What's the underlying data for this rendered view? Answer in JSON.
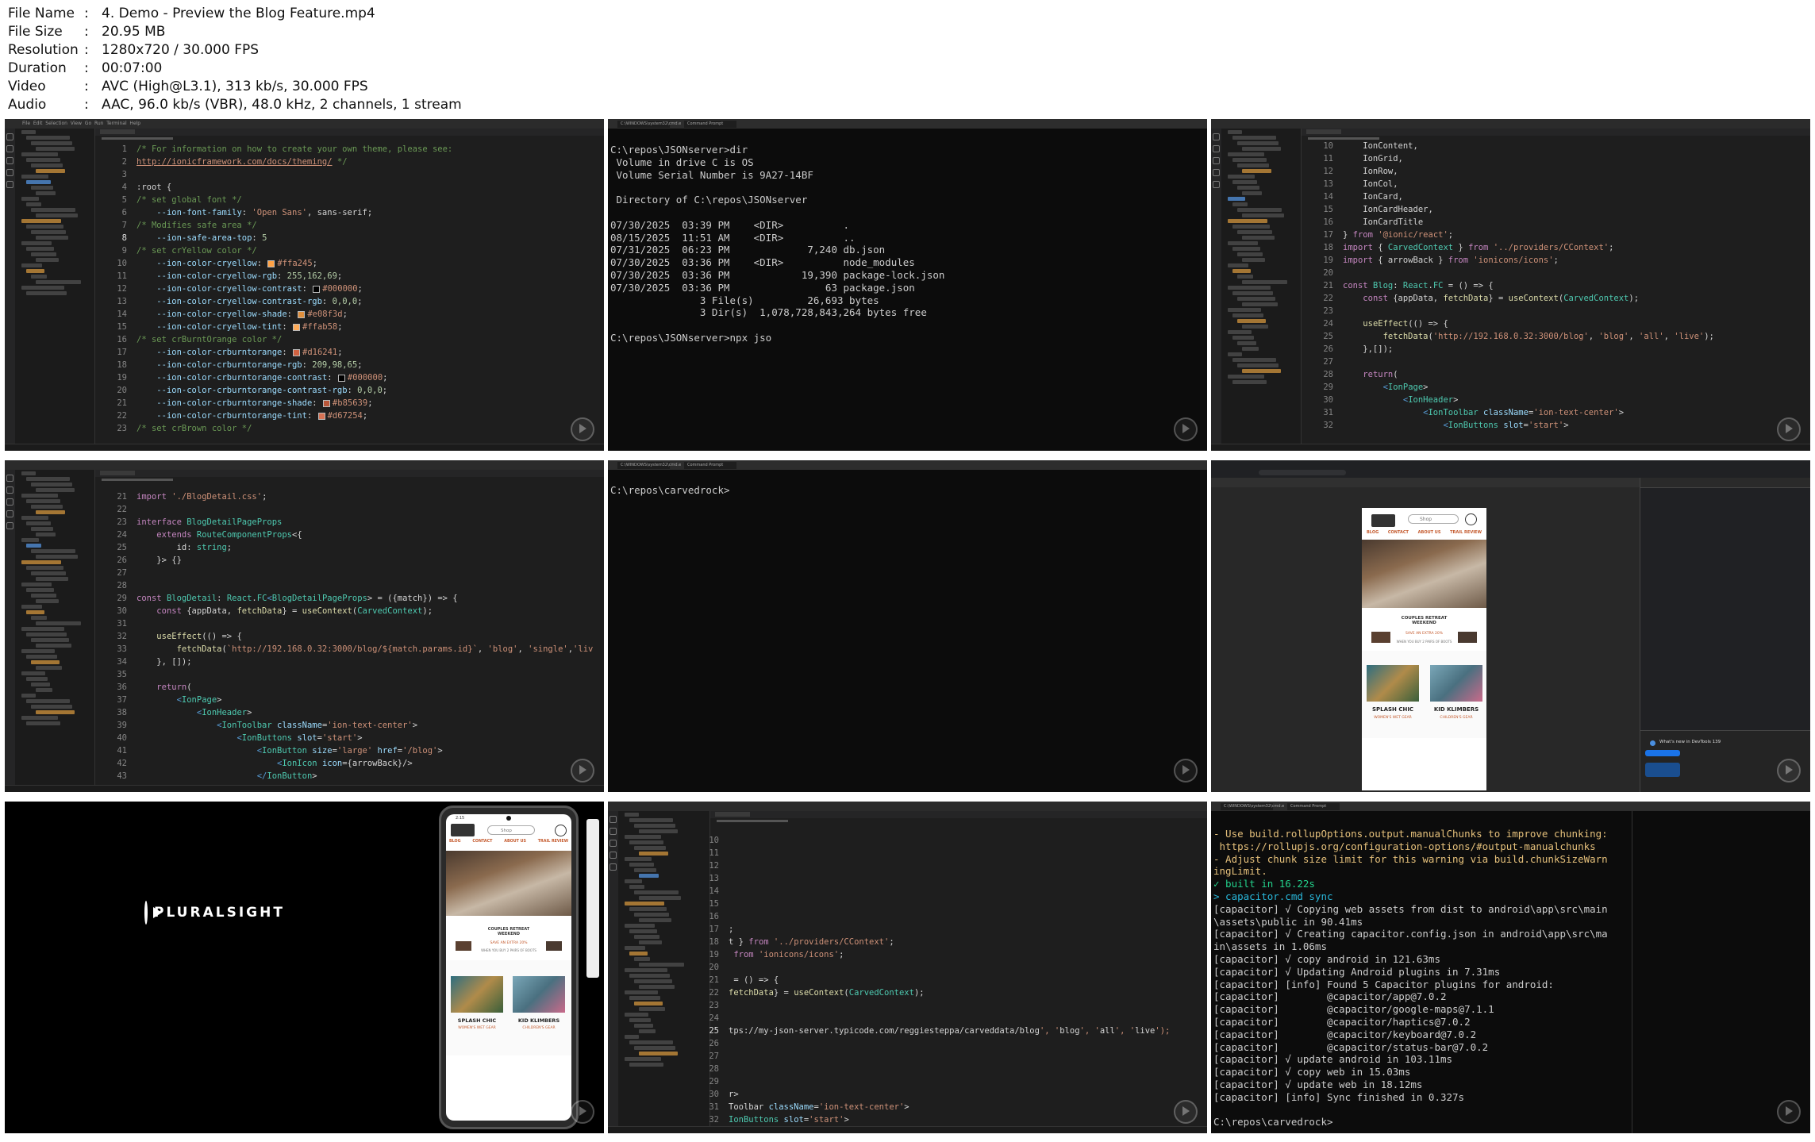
{
  "file_info": [
    {
      "key": "File Name",
      "value": "4. Demo - Preview the Blog Feature.mp4"
    },
    {
      "key": "File Size",
      "value": "20.95 MB"
    },
    {
      "key": "Resolution",
      "value": "1280x720 / 30.000 FPS"
    },
    {
      "key": "Duration",
      "value": "00:07:00"
    },
    {
      "key": "Video",
      "value": "AVC (High@L3.1), 313 kb/s, 30.000 FPS"
    },
    {
      "key": "Audio",
      "value": "AAC, 96.0 kb/s (VBR), 48.0 kHz, 2 channels, 1 stream"
    }
  ],
  "thumb1": {
    "menu": "File  Edit  Selection  View  Go  Run  Terminal  Help",
    "lines": [
      {
        "n": "1",
        "t": "/* For information on how to create your own theme, please see:"
      },
      {
        "n": "2",
        "t": "http://ionicframework.com/docs/theming/ */"
      },
      {
        "n": "3",
        "t": ""
      },
      {
        "n": "4",
        "t": ":root {"
      },
      {
        "n": "5",
        "t": "/* set global font */"
      },
      {
        "n": "6",
        "t": "    --ion-font-family: 'Open Sans', sans-serif;"
      },
      {
        "n": "7",
        "t": "/* Modifies safe area */"
      },
      {
        "n": "8",
        "t": "    --ion-safe-area-top: 5"
      },
      {
        "n": "9",
        "t": "/* set crYellow color */"
      },
      {
        "n": "10",
        "t": "    --ion-color-cryellow: #ffa245;"
      },
      {
        "n": "11",
        "t": "    --ion-color-cryellow-rgb: 255,162,69;"
      },
      {
        "n": "12",
        "t": "    --ion-color-cryellow-contrast: #000000;"
      },
      {
        "n": "13",
        "t": "    --ion-color-cryellow-contrast-rgb: 0,0,0;"
      },
      {
        "n": "14",
        "t": "    --ion-color-cryellow-shade: #e08f3d;"
      },
      {
        "n": "15",
        "t": "    --ion-color-cryellow-tint: #ffab58;"
      },
      {
        "n": "16",
        "t": "/* set crBurntOrange color */"
      },
      {
        "n": "17",
        "t": "    --ion-color-crburntorange: #d16241;"
      },
      {
        "n": "18",
        "t": "    --ion-color-crburntorange-rgb: 209,98,65;"
      },
      {
        "n": "19",
        "t": "    --ion-color-crburntorange-contrast: #000000;"
      },
      {
        "n": "20",
        "t": "    --ion-color-crburntorange-contrast-rgb: 0,0,0;"
      },
      {
        "n": "21",
        "t": "    --ion-color-crburntorange-shade: #b85639;"
      },
      {
        "n": "22",
        "t": "    --ion-color-crburntorange-tint: #d67254;"
      },
      {
        "n": "23",
        "t": "/* set crBrown color */"
      }
    ]
  },
  "thumb2": {
    "tab1": "C:\\WINDOWS\\system32\\cmd.e",
    "tab2": "Command Prompt",
    "lines": [
      "C:\\repos\\JSONserver>dir",
      " Volume in drive C is OS",
      " Volume Serial Number is 9A27-14BF",
      "",
      " Directory of C:\\repos\\JSONserver",
      "",
      "07/30/2025  03:39 PM    <DIR>          .",
      "08/15/2025  11:51 AM    <DIR>          ..",
      "07/31/2025  06:23 PM             7,240 db.json",
      "07/30/2025  03:36 PM    <DIR>          node_modules",
      "07/30/2025  03:36 PM            19,390 package-lock.json",
      "07/30/2025  03:36 PM                63 package.json",
      "               3 File(s)         26,693 bytes",
      "               3 Dir(s)  1,078,728,843,264 bytes free",
      "",
      "C:\\repos\\JSONserver>npx jso"
    ]
  },
  "thumb3": {
    "lines": [
      {
        "n": "10",
        "t": "    IonContent,"
      },
      {
        "n": "11",
        "t": "    IonGrid,"
      },
      {
        "n": "12",
        "t": "    IonRow,"
      },
      {
        "n": "13",
        "t": "    IonCol,"
      },
      {
        "n": "14",
        "t": "    IonCard,"
      },
      {
        "n": "15",
        "t": "    IonCardHeader,"
      },
      {
        "n": "16",
        "t": "    IonCardTitle"
      },
      {
        "n": "17",
        "t": "} from '@ionic/react';"
      },
      {
        "n": "18",
        "t": "import { CarvedContext } from '../providers/CContext';"
      },
      {
        "n": "19",
        "t": "import { arrowBack } from 'ionicons/icons';"
      },
      {
        "n": "20",
        "t": ""
      },
      {
        "n": "21",
        "t": "const Blog: React.FC = () => {"
      },
      {
        "n": "22",
        "t": "    const {appData, fetchData} = useContext(CarvedContext);"
      },
      {
        "n": "23",
        "t": ""
      },
      {
        "n": "24",
        "t": "    useEffect(() => {"
      },
      {
        "n": "25",
        "t": "        fetchData('http://192.168.0.32:3000/blog', 'blog', 'all', 'live');"
      },
      {
        "n": "26",
        "t": "    },[]);"
      },
      {
        "n": "27",
        "t": ""
      },
      {
        "n": "28",
        "t": "    return("
      },
      {
        "n": "29",
        "t": "        <IonPage>"
      },
      {
        "n": "30",
        "t": "            <IonHeader>"
      },
      {
        "n": "31",
        "t": "                <IonToolbar className='ion-text-center'>"
      },
      {
        "n": "32",
        "t": "                    <IonButtons slot='start'>"
      }
    ]
  },
  "thumb4": {
    "lines": [
      {
        "n": "21",
        "t": "import './BlogDetail.css';"
      },
      {
        "n": "22",
        "t": ""
      },
      {
        "n": "23",
        "t": "interface BlogDetailPageProps"
      },
      {
        "n": "24",
        "t": "    extends RouteComponentProps<{"
      },
      {
        "n": "25",
        "t": "        id: string;"
      },
      {
        "n": "26",
        "t": "    }> {}"
      },
      {
        "n": "27",
        "t": ""
      },
      {
        "n": "28",
        "t": ""
      },
      {
        "n": "29",
        "t": "const BlogDetail: React.FC<BlogDetailPageProps> = ({match}) => {"
      },
      {
        "n": "30",
        "t": "    const {appData, fetchData} = useContext(CarvedContext);"
      },
      {
        "n": "31",
        "t": ""
      },
      {
        "n": "32",
        "t": "    useEffect(() => {"
      },
      {
        "n": "33",
        "t": "        fetchData(`http://192.168.0.32:3000/blog/${match.params.id}`, 'blog', 'single','liv"
      },
      {
        "n": "34",
        "t": "    }, []);"
      },
      {
        "n": "35",
        "t": ""
      },
      {
        "n": "36",
        "t": "    return("
      },
      {
        "n": "37",
        "t": "        <IonPage>"
      },
      {
        "n": "38",
        "t": "            <IonHeader>"
      },
      {
        "n": "39",
        "t": "                <IonToolbar className='ion-text-center'>"
      },
      {
        "n": "40",
        "t": "                    <IonButtons slot='start'>"
      },
      {
        "n": "41",
        "t": "                        <IonButton size='large' href='/blog'>"
      },
      {
        "n": "42",
        "t": "                            <IonIcon icon={arrowBack}/>"
      },
      {
        "n": "43",
        "t": "                        </IonButton>"
      }
    ]
  },
  "thumb5": {
    "lines": [
      "C:\\repos\\carvedrock>"
    ]
  },
  "thumb6": {
    "nav": [
      "BLOG",
      "CONTACT",
      "ABOUT US",
      "TRAIL REVIEW"
    ],
    "search": "Shop",
    "promo_title": "COUPLES RETREAT WEEKEND",
    "promo_sub": "SAVE AN EXTRA 20%",
    "promo_note": "WHEN YOU BUY 2 PAIRS OF BOOTS",
    "card1_title": "SPLASH CHIC",
    "card1_sub": "WOMEN'S WET GEAR",
    "card2_title": "KID KLIMBERS",
    "card2_sub": "CHILDREN'S GEAR",
    "devtools_title": "What's new in DevTools 139"
  },
  "thumb7": {
    "brand": "PLURALSIGHT",
    "time": "2:15",
    "search": "Shop",
    "nav": [
      "BLOG",
      "CONTACT",
      "ABOUT US",
      "TRAIL REVIEW"
    ],
    "promo_title": "COUPLES RETREAT WEEKEND",
    "promo_sub": "SAVE AN EXTRA 20%",
    "promo_note": "WHEN YOU BUY 2 PAIRS OF BOOTS",
    "card1_title": "SPLASH CHIC",
    "card1_sub": "WOMEN'S WET GEAR",
    "card2_title": "KID KLIMBERS",
    "card2_sub": "CHILDREN'S GEAR"
  },
  "thumb8": {
    "lines": [
      {
        "n": "10",
        "t": ""
      },
      {
        "n": "11",
        "t": ""
      },
      {
        "n": "12",
        "t": ""
      },
      {
        "n": "13",
        "t": ""
      },
      {
        "n": "14",
        "t": ""
      },
      {
        "n": "15",
        "t": ""
      },
      {
        "n": "16",
        "t": ""
      },
      {
        "n": "17",
        "t": ";"
      },
      {
        "n": "18",
        "t": "t } from '../providers/CContext';"
      },
      {
        "n": "19",
        "t": " from 'ionicons/icons';"
      },
      {
        "n": "20",
        "t": ""
      },
      {
        "n": "21",
        "t": " = () => {"
      },
      {
        "n": "22",
        "t": "fetchData} = useContext(CarvedContext);"
      },
      {
        "n": "23",
        "t": ""
      },
      {
        "n": "24",
        "t": ""
      },
      {
        "n": "25",
        "t": "tps://my-json-server.typicode.com/reggiesteppa/carveddata/blog', 'blog', 'all', 'live');"
      },
      {
        "n": "26",
        "t": ""
      },
      {
        "n": "27",
        "t": ""
      },
      {
        "n": "28",
        "t": ""
      },
      {
        "n": "29",
        "t": ""
      },
      {
        "n": "30",
        "t": "r>"
      },
      {
        "n": "31",
        "t": "Toolbar className='ion-text-center'>"
      },
      {
        "n": "32",
        "t": "IonButtons slot='start'>"
      }
    ]
  },
  "thumb9": {
    "lines": [
      {
        "c": "w",
        "t": "- Use build.rollupOptions.output.manualChunks to improve chunking:"
      },
      {
        "c": "w",
        "t": " https://rollupjs.org/configuration-options/#output-manualchunks"
      },
      {
        "c": "w",
        "t": "- Adjust chunk size limit for this warning via build.chunkSizeWarn"
      },
      {
        "c": "w",
        "t": "ingLimit."
      },
      {
        "c": "g",
        "t": "✓ built in 16.22s"
      },
      {
        "c": "c",
        "t": "> capacitor.cmd sync"
      },
      {
        "c": "n",
        "t": "[capacitor] √ Copying web assets from dist to android\\app\\src\\main"
      },
      {
        "c": "n",
        "t": "\\assets\\public in 90.41ms"
      },
      {
        "c": "n",
        "t": "[capacitor] √ Creating capacitor.config.json in android\\app\\src\\ma"
      },
      {
        "c": "n",
        "t": "in\\assets in 1.06ms"
      },
      {
        "c": "n",
        "t": "[capacitor] √ copy android in 121.63ms"
      },
      {
        "c": "n",
        "t": "[capacitor] √ Updating Android plugins in 7.31ms"
      },
      {
        "c": "n",
        "t": "[capacitor] [info] Found 5 Capacitor plugins for android:"
      },
      {
        "c": "n",
        "t": "[capacitor]        @capacitor/app@7.0.2"
      },
      {
        "c": "n",
        "t": "[capacitor]        @capacitor/google-maps@7.1.1"
      },
      {
        "c": "n",
        "t": "[capacitor]        @capacitor/haptics@7.0.2"
      },
      {
        "c": "n",
        "t": "[capacitor]        @capacitor/keyboard@7.0.2"
      },
      {
        "c": "n",
        "t": "[capacitor]        @capacitor/status-bar@7.0.2"
      },
      {
        "c": "n",
        "t": "[capacitor] √ update android in 103.11ms"
      },
      {
        "c": "n",
        "t": "[capacitor] √ copy web in 15.03ms"
      },
      {
        "c": "n",
        "t": "[capacitor] √ update web in 18.12ms"
      },
      {
        "c": "n",
        "t": "[capacitor] [info] Sync finished in 0.327s"
      },
      {
        "c": "n",
        "t": ""
      },
      {
        "c": "n",
        "t": "C:\\repos\\carvedrock>"
      }
    ]
  }
}
